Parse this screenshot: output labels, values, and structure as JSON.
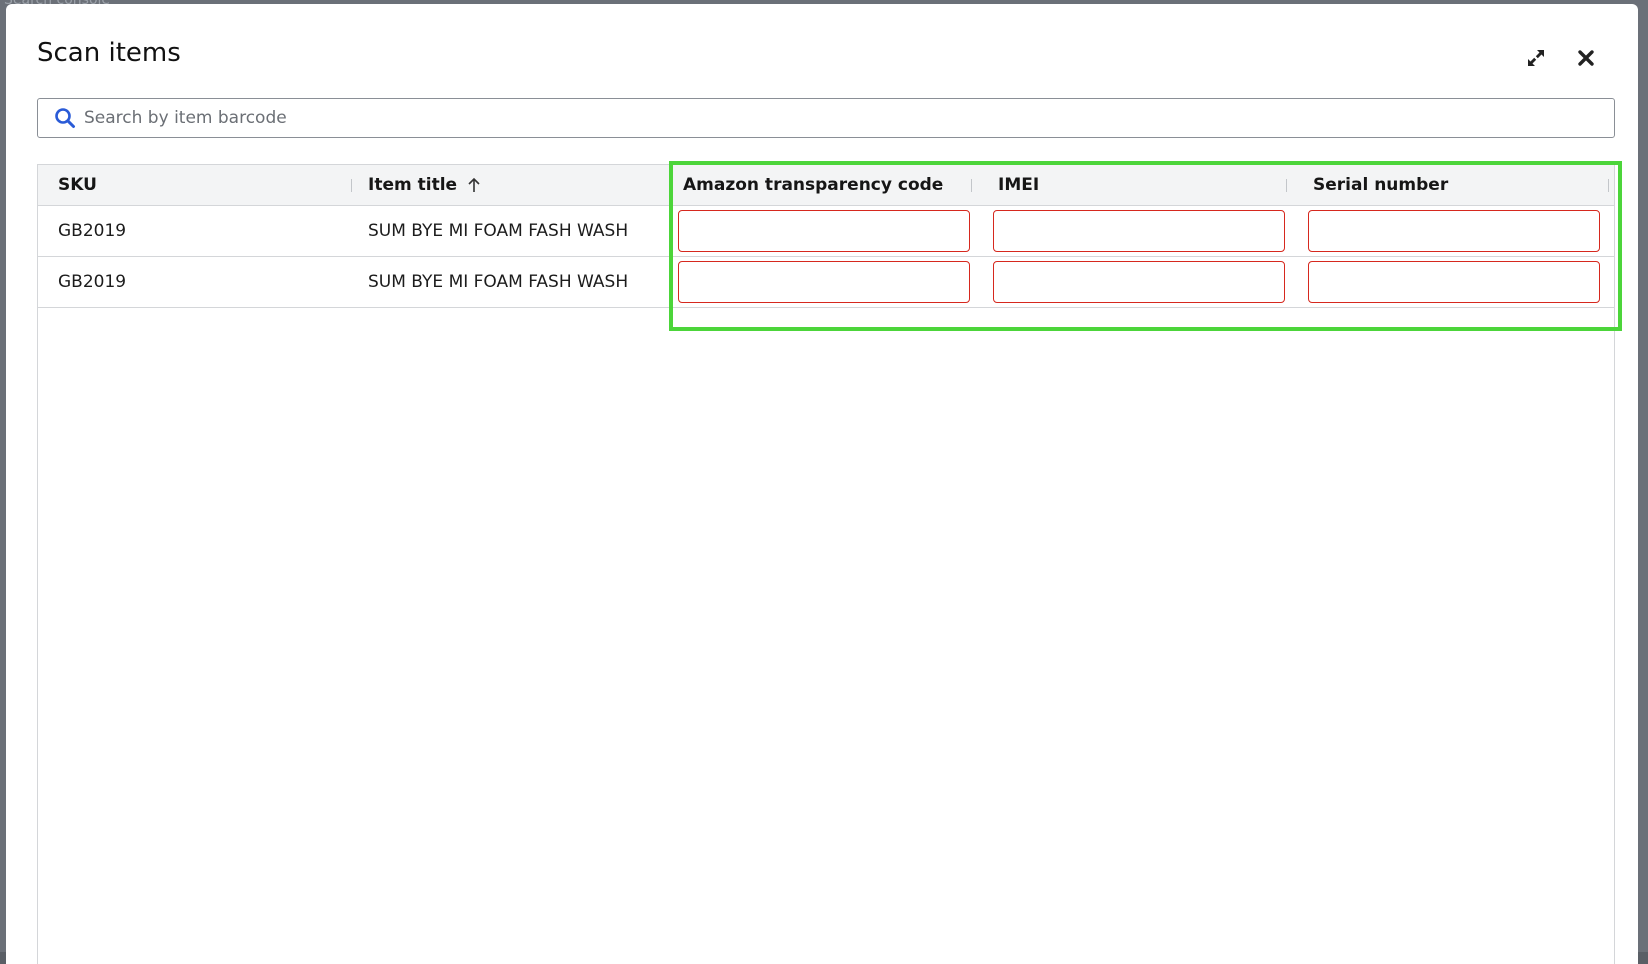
{
  "backdrop": {
    "text": "Search console"
  },
  "modal": {
    "title": "Scan items",
    "expand_icon": "expand-icon",
    "close_icon": "close-icon"
  },
  "search": {
    "placeholder": "Search by item barcode",
    "value": "",
    "icon": "search-icon",
    "icon_color": "#2a5bd7"
  },
  "table": {
    "columns": [
      {
        "label": "SKU"
      },
      {
        "label": "Item title",
        "sort": "ascending",
        "sort_icon": "arrow-up-icon"
      },
      {
        "label": "Amazon transparency code"
      },
      {
        "label": "IMEI"
      },
      {
        "label": "Serial number"
      }
    ],
    "rows": [
      {
        "sku": "GB2019",
        "title": "SUM BYE MI FOAM FASH WASH",
        "transparency_code": "",
        "imei": "",
        "serial_number": ""
      },
      {
        "sku": "GB2019",
        "title": "SUM BYE MI FOAM FASH WASH",
        "transparency_code": "",
        "imei": "",
        "serial_number": ""
      }
    ]
  },
  "colors": {
    "invalid_border": "#d6281e",
    "highlight": "#4cd53a",
    "header_bg": "#f3f4f5"
  }
}
